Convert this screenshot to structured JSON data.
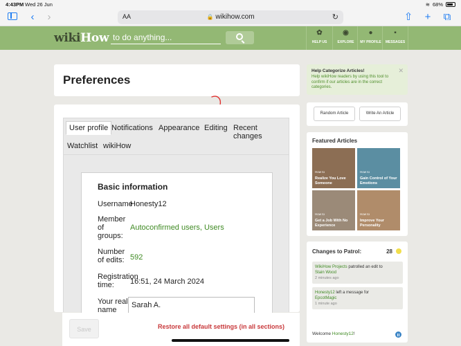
{
  "status_bar": {
    "time": "4:43PM",
    "date": "Wed 26 Jun",
    "battery": "68%"
  },
  "browser": {
    "text_size_label": "AA",
    "url": "wikihow.com"
  },
  "header": {
    "logo_wiki": "wiki",
    "logo_how": "How",
    "search_placeholder": "to do anything...",
    "nav": [
      "HELP US",
      "EXPLORE",
      "MY PROFILE",
      "MESSAGES"
    ]
  },
  "page": {
    "title": "Preferences",
    "tabs": [
      "User profile",
      "Notifications",
      "Appearance",
      "Editing",
      "Recent changes",
      "Watchlist",
      "wikiHow"
    ],
    "active_tab": "User profile",
    "section_title": "Basic information",
    "fields": {
      "username_label": "Username",
      "username_value": "Honesty12",
      "groups_label_1": "Member",
      "groups_label_2": "of",
      "groups_label_3": "groups:",
      "groups_value": "Autoconfirmed users, Users",
      "edits_label_1": "Number",
      "edits_label_2": "of edits:",
      "edits_value": "592",
      "registration_label_1": "Registration",
      "registration_label_2": "time:",
      "registration_value": "16:51, 24 March 2024",
      "realname_label_1": "Your real",
      "realname_label_2": "name",
      "realname_value": "Sarah A."
    },
    "save_label": "Save",
    "restore_label": "Restore all default settings (in all sections)"
  },
  "sidebar": {
    "help": {
      "title": "Help Categorize Articles!",
      "text": "Help wikiHow readers by using this tool to confirm if our articles are in the correct categories."
    },
    "random_article": "Random Article",
    "write_article": "Write An Article",
    "featured_title": "Featured Articles",
    "featured": [
      {
        "howto": "How to",
        "title": "Realize You Love Someone",
        "color": "#8c6e54"
      },
      {
        "howto": "How to",
        "title": "Gain Control of Your Emotions",
        "color": "#5b8ea2"
      },
      {
        "howto": "How to",
        "title": "Get a Job With No Experience",
        "color": "#9b8a78"
      },
      {
        "howto": "How to",
        "title": "Improve Your Personality",
        "color": "#b08c6a"
      }
    ],
    "patrol": {
      "title": "Changes to Patrol:",
      "count": "28",
      "items": [
        {
          "actor": "WikiHow Projects",
          "action": " patrolled an edit to ",
          "target": "Stain Wood",
          "time": "2 minutes ago"
        },
        {
          "actor": "Honesty12",
          "action": " left a message for ",
          "target": "EpcotMagic",
          "time": "1 minute ago"
        }
      ],
      "welcome_prefix": "Welcome ",
      "welcome_user": "Honesty12",
      "welcome_suffix": "!"
    }
  }
}
